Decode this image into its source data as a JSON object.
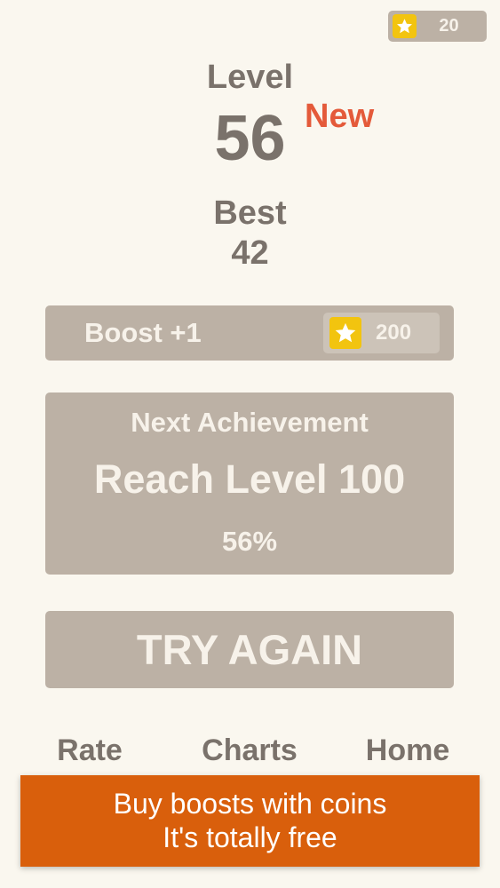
{
  "header": {
    "coins": "20",
    "coin_icon": "star-icon"
  },
  "score": {
    "level_label": "Level",
    "level_number": "56",
    "new_tag": "New",
    "best_label": "Best",
    "best_value": "42"
  },
  "boost": {
    "label": "Boost +1",
    "price": "200",
    "price_icon": "star-icon"
  },
  "achievement": {
    "heading": "Next Achievement",
    "goal": "Reach Level 100",
    "progress": "56%"
  },
  "actions": {
    "try_again": "TRY AGAIN"
  },
  "nav": {
    "rate": "Rate",
    "charts": "Charts",
    "home": "Home"
  },
  "promo": {
    "line1": "Buy boosts with coins",
    "line2": "It's totally free"
  },
  "colors": {
    "background": "#faf7ef",
    "panel": "#bcb1a5",
    "text_dark": "#7a726b",
    "accent_new": "#e45a3a",
    "star": "#f2c40f",
    "banner": "#d95f0c"
  }
}
